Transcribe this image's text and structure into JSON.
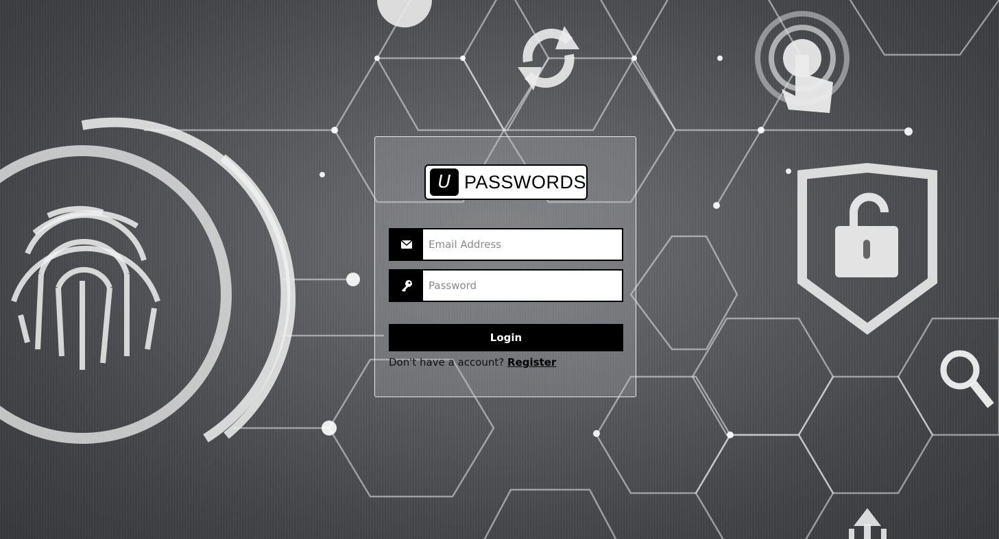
{
  "logo": {
    "mark": "U",
    "text": "PASSWORDS"
  },
  "form": {
    "email_placeholder": "Email Address",
    "password_placeholder": "Password",
    "login_label": "Login",
    "register_prompt": "Don't have a account?",
    "register_link": "Register"
  },
  "icons": {
    "email": "envelope-icon",
    "password": "key-icon"
  },
  "colors": {
    "button": "#000000",
    "button_text": "#ffffff",
    "card_border": "#e8e8e8"
  }
}
